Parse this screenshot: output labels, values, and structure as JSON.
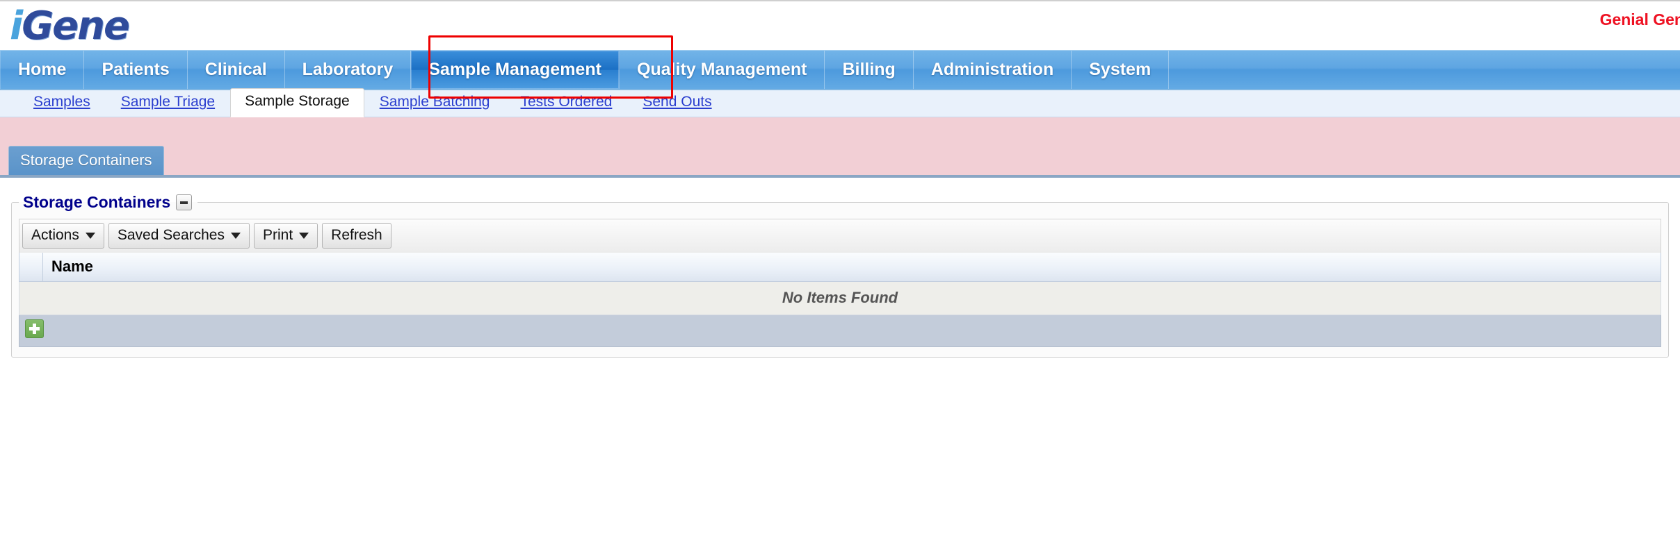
{
  "header": {
    "logo_text_i": "i",
    "logo_text_rest": "Gene",
    "account_name": "Genial Gen"
  },
  "main_nav": {
    "items": [
      {
        "label": "Home",
        "active": false
      },
      {
        "label": "Patients",
        "active": false
      },
      {
        "label": "Clinical",
        "active": false
      },
      {
        "label": "Laboratory",
        "active": false
      },
      {
        "label": "Sample Management",
        "active": true
      },
      {
        "label": "Quality Management",
        "active": false
      },
      {
        "label": "Billing",
        "active": false
      },
      {
        "label": "Administration",
        "active": false
      },
      {
        "label": "System",
        "active": false
      }
    ]
  },
  "sub_nav": {
    "items": [
      {
        "label": "Samples",
        "active": false
      },
      {
        "label": "Sample Triage",
        "active": false
      },
      {
        "label": "Sample Storage",
        "active": true
      },
      {
        "label": "Sample Batching",
        "active": false
      },
      {
        "label": "Tests Ordered",
        "active": false
      },
      {
        "label": "Send Outs",
        "active": false
      }
    ]
  },
  "module_tab": {
    "label": "Storage Containers"
  },
  "panel": {
    "title": "Storage Containers",
    "collapse_icon": "minus-icon"
  },
  "toolbar": {
    "actions_label": "Actions",
    "saved_searches_label": "Saved Searches",
    "print_label": "Print",
    "refresh_label": "Refresh"
  },
  "grid": {
    "columns": [
      "Name"
    ],
    "rows": [],
    "empty_message": "No Items Found",
    "add_icon": "plus-icon"
  },
  "annotation": {
    "target": "Sample Management",
    "color": "#ee0000"
  },
  "colors": {
    "nav_blue": "#5ea5e2",
    "nav_active_blue": "#1b6fc4",
    "pink_band": "#f2cfd5",
    "link_blue": "#2b3fcf",
    "panel_title": "#00008b",
    "account_red": "#ee1122",
    "add_green": "#6aa94f"
  }
}
